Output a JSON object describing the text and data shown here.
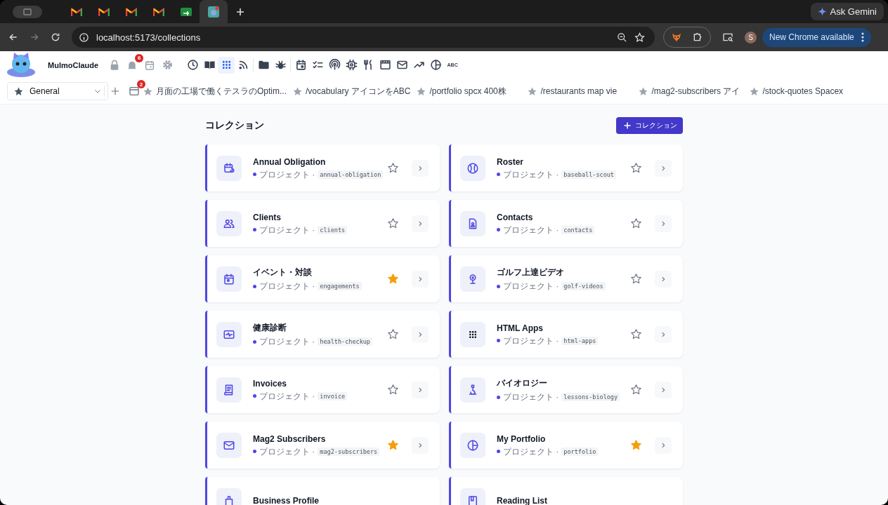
{
  "browser": {
    "tabs": [
      {
        "kind": "group",
        "selected": false
      },
      {
        "kind": "mail",
        "selected": false
      },
      {
        "kind": "mail",
        "selected": false
      },
      {
        "kind": "mail",
        "selected": false
      },
      {
        "kind": "mail",
        "selected": false
      },
      {
        "kind": "sheet",
        "selected": false
      },
      {
        "kind": "app",
        "selected": true
      }
    ],
    "ask_gemini": "Ask Gemini",
    "url": "localhost:5173/collections",
    "profile_initial": "S",
    "update_button": "New Chrome available"
  },
  "app": {
    "name": "MulmoClaude",
    "notifications_badge": "6",
    "toolbar_groups": [
      [
        {
          "selected": false
        },
        {
          "selected": false
        },
        {
          "selected": true
        },
        {
          "selected": false
        }
      ],
      [
        {
          "selected": false
        },
        {
          "selected": false
        }
      ],
      [
        {
          "selected": false
        },
        {
          "selected": false
        },
        {
          "selected": false
        },
        {
          "selected": false
        },
        {
          "selected": false
        },
        {
          "selected": false
        },
        {
          "selected": false
        },
        {
          "selected": false
        },
        {
          "selected": false
        },
        {
          "label": "ABC",
          "selected": false
        }
      ]
    ],
    "workspace": "General",
    "calendar_badge": "2",
    "shortcuts": [
      "月面の工場で働くテスラのOptim...",
      "/vocabulary アイコンをABC",
      "/portfolio spcx 400株",
      "/restaurants map vie",
      "/mag2-subscribers アイ",
      "/stock-quotes Spacex"
    ]
  },
  "page": {
    "title": "コレクション",
    "add_button": "コレクション",
    "collections": [
      {
        "title": "Annual Obligation",
        "type_label": "プロジェクト ·",
        "slug": "annual-obligation",
        "starred": false
      },
      {
        "title": "Roster",
        "type_label": "プロジェクト ·",
        "slug": "baseball-scout",
        "starred": false
      },
      {
        "title": "Clients",
        "type_label": "プロジェクト ·",
        "slug": "clients",
        "starred": false
      },
      {
        "title": "Contacts",
        "type_label": "プロジェクト ·",
        "slug": "contacts",
        "starred": false
      },
      {
        "title": "イベント・対談",
        "type_label": "プロジェクト ·",
        "slug": "engagements",
        "starred": true
      },
      {
        "title": "ゴルフ上達ビデオ",
        "type_label": "プロジェクト ·",
        "slug": "golf-videos",
        "starred": false
      },
      {
        "title": "健康診断",
        "type_label": "プロジェクト ·",
        "slug": "health-checkup",
        "starred": false
      },
      {
        "title": "HTML Apps",
        "type_label": "プロジェクト ·",
        "slug": "html-apps",
        "starred": false
      },
      {
        "title": "Invoices",
        "type_label": "プロジェクト ·",
        "slug": "invoice",
        "starred": false
      },
      {
        "title": "バイオロジー",
        "type_label": "プロジェクト ·",
        "slug": "lessons-biology",
        "starred": false
      },
      {
        "title": "Mag2 Subscribers",
        "type_label": "プロジェクト ·",
        "slug": "mag2-subscribers",
        "starred": true
      },
      {
        "title": "My Portfolio",
        "type_label": "プロジェクト ·",
        "slug": "portfolio",
        "starred": true
      },
      {
        "title": "Business Profile"
      },
      {
        "title": "Reading List"
      }
    ]
  }
}
